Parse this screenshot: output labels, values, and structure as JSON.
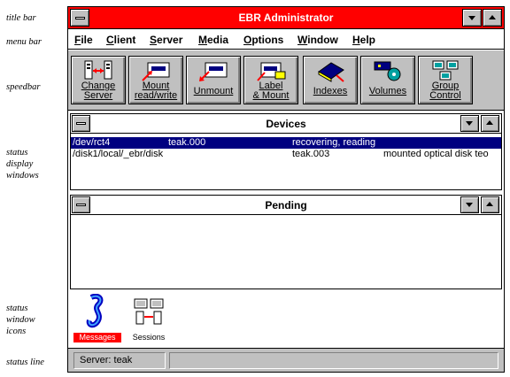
{
  "annotations": {
    "title_bar": "title bar",
    "menu_bar": "menu bar",
    "speedbar": "speedbar",
    "status_display": [
      "status",
      "display",
      "windows"
    ],
    "status_icons": [
      "status",
      "window",
      "icons"
    ],
    "status_line": "status line"
  },
  "window": {
    "title": "EBR Administrator"
  },
  "menu": {
    "items": [
      {
        "label": "File",
        "accel": "F"
      },
      {
        "label": "Client",
        "accel": "C"
      },
      {
        "label": "Server",
        "accel": "S"
      },
      {
        "label": "Media",
        "accel": "M"
      },
      {
        "label": "Options",
        "accel": "O"
      },
      {
        "label": "Window",
        "accel": "W"
      },
      {
        "label": "Help",
        "accel": "H"
      }
    ]
  },
  "speedbar": {
    "buttons": [
      {
        "line1": "Change",
        "line2": "Server",
        "icon": "change-server-icon"
      },
      {
        "line1": "Mount",
        "line2": "read/write",
        "icon": "mount-readwrite-icon"
      },
      {
        "line1": "",
        "line2": "Unmount",
        "icon": "unmount-icon"
      },
      {
        "line1": "Label",
        "line2": "& Mount",
        "icon": "label-mount-icon"
      },
      {
        "line1": "",
        "line2": "Indexes",
        "icon": "indexes-icon"
      },
      {
        "line1": "",
        "line2": "Volumes",
        "icon": "volumes-icon"
      },
      {
        "line1": "Group",
        "line2": "Control",
        "icon": "group-control-icon"
      }
    ]
  },
  "devices": {
    "title": "Devices",
    "rows": [
      {
        "device": "/dev/rct4",
        "volume": "teak.000",
        "status": "recovering, reading",
        "selected": true
      },
      {
        "device": "/disk1/local/_ebr/disk",
        "volume": "teak.003",
        "status": "mounted optical disk teo",
        "selected": false
      }
    ]
  },
  "pending": {
    "title": "Pending"
  },
  "icons": {
    "messages": "Messages",
    "sessions": "Sessions"
  },
  "statusline": {
    "server": "Server: teak"
  },
  "colors": {
    "title": "#ff0000",
    "selection": "#000080",
    "chrome": "#c0c0c0"
  }
}
